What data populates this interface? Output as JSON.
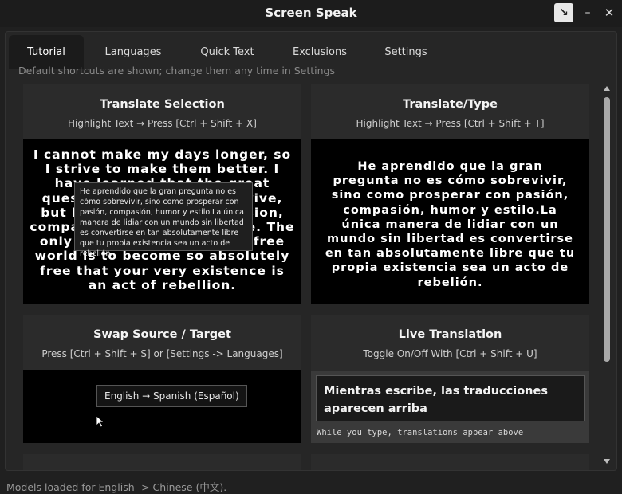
{
  "window": {
    "title": "Screen Speak",
    "pin_icon": "pin-icon",
    "minimize_label": "–",
    "close_label": "✕"
  },
  "tabs": [
    {
      "label": "Tutorial",
      "active": true
    },
    {
      "label": "Languages",
      "active": false
    },
    {
      "label": "Quick Text",
      "active": false
    },
    {
      "label": "Exclusions",
      "active": false
    },
    {
      "label": "Settings",
      "active": false
    }
  ],
  "hint": "Default shortcuts are shown; change them any time in Settings",
  "cards": {
    "translate_selection": {
      "title": "Translate Selection",
      "subtitle": "Highlight Text → Press [Ctrl + Shift + X]",
      "source_text": "I cannot make my days longer, so I strive to make them better. I have learned that the great question is not how to survive, but how to thrive with passion, compassion, humor and style. The only way to deal with an unfree world is to become so absolutely free that your very existence is an act of rebellion.",
      "tooltip": "He aprendido que la gran pregunta no es cómo sobrevivir, sino como prosperar con pasión, compasión, humor y estilo.La única manera de lidiar con un mundo sin libertad es convertirse en tan absolutamente libre que tu propia existencia sea un acto de rebelión."
    },
    "translate_type": {
      "title": "Translate/Type",
      "subtitle": "Highlight Text → Press [Ctrl + Shift + T]",
      "result_text": "He aprendido que la gran pregunta no es cómo sobrevivir, sino como prosperar con pasión, compasión, humor y estilo.La única manera de lidiar con un mundo sin libertad es convertirse en tan absolutamente libre que tu propia existencia sea un acto de rebelión."
    },
    "swap": {
      "title": "Swap Source / Target",
      "subtitle": "Press [Ctrl + Shift + S] or [Settings -> Languages]",
      "box_label": "English → Spanish (Español)"
    },
    "live": {
      "title": "Live Translation",
      "subtitle": "Toggle On/Off With [Ctrl + Shift + U]",
      "output_text": "Mientras escribe, las traducciones aparecen arriba",
      "input_text": "While you type, translations appear above"
    }
  },
  "status": "Models loaded for English -> Chinese (中文)."
}
